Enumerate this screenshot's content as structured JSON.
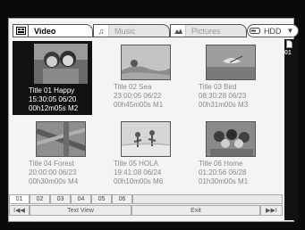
{
  "tabs": [
    {
      "label": "Video",
      "icon": "film-icon"
    },
    {
      "label": "Music",
      "icon": "music-note-icon"
    },
    {
      "label": "Pictures",
      "icon": "picture-icon"
    }
  ],
  "source": {
    "label": "HDD",
    "icon": "hdd-icon"
  },
  "rail": {
    "page_number": "01"
  },
  "titles": [
    {
      "name": "Title 01 Happy",
      "datetime": "15:30:05 06/20",
      "info": "00h12m05s M2"
    },
    {
      "name": "Title 02 Sea",
      "datetime": "23:00:05 06/22",
      "info": "00h45m00s M1"
    },
    {
      "name": "Title 03 Bird",
      "datetime": "08:30:28 06/23",
      "info": "00h31m00s M3"
    },
    {
      "name": "Title 04 Forest",
      "datetime": "20:00:00 06/23",
      "info": "00h30m00s M4"
    },
    {
      "name": "Title 05 HOLA",
      "datetime": "19:41:08 06/24",
      "info": "00h10m00s M6"
    },
    {
      "name": "Title 06 Home",
      "datetime": "01:20:56 06/28",
      "info": "01h30m00s M1"
    }
  ],
  "pages": [
    "01",
    "02",
    "03",
    "04",
    "05",
    "06"
  ],
  "bottom": {
    "prev": "I◀◀",
    "text_view": "Text View",
    "exit": "Exit",
    "next": "▶▶I"
  }
}
